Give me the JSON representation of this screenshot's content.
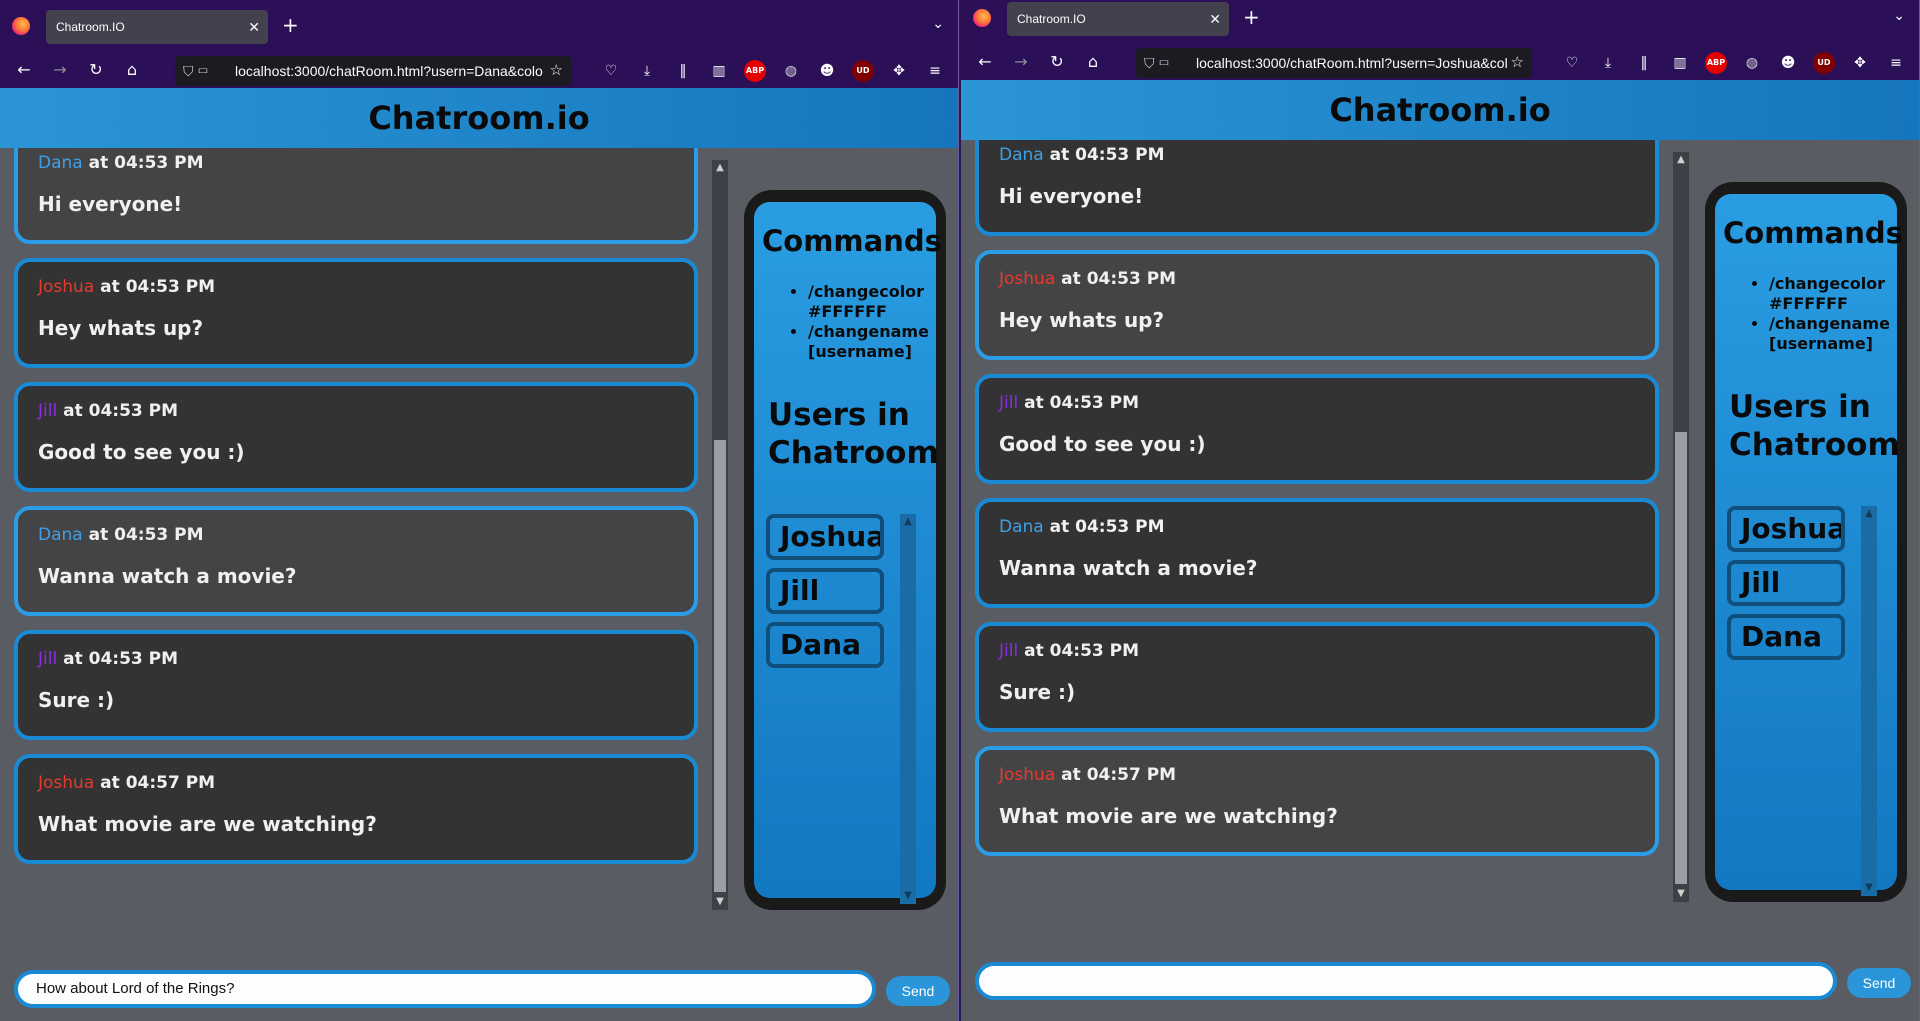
{
  "colors": {
    "accent": "#1a8ad4",
    "dana": "#3f9fe6",
    "joshua": "#e83a2a",
    "jill": "#8a2ee0",
    "browser_chrome": "#2b1057"
  },
  "left": {
    "tab_title": "Chatroom.IO",
    "url": "localhost:3000/chatRoom.html?usern=Dana&colo",
    "app_title": "Chatroom.io",
    "messages": [
      {
        "user": "Dana",
        "time": "at 04:53 PM",
        "text": "Hi everyone!",
        "own": true
      },
      {
        "user": "Joshua",
        "time": "at 04:53 PM",
        "text": "Hey whats up?",
        "own": false
      },
      {
        "user": "Jill",
        "time": "at 04:53 PM",
        "text": "Good to see you :)",
        "own": false
      },
      {
        "user": "Dana",
        "time": "at 04:53 PM",
        "text": "Wanna watch a movie?",
        "own": true
      },
      {
        "user": "Jill",
        "time": "at 04:53 PM",
        "text": "Sure :)",
        "own": false
      },
      {
        "user": "Joshua",
        "time": "at 04:57 PM",
        "text": "What movie are we watching?",
        "own": false
      }
    ],
    "commands_title": "Commands",
    "commands": [
      "/changecolor #FFFFFF",
      "/changename [username]"
    ],
    "users_title": "Users in Chatroom",
    "users": [
      "Joshua",
      "Jill",
      "Dana"
    ],
    "input_value": "How about Lord of the Rings?",
    "send_label": "Send"
  },
  "right": {
    "tab_title": "Chatroom.IO",
    "url": "localhost:3000/chatRoom.html?usern=Joshua&col",
    "app_title": "Chatroom.io",
    "messages": [
      {
        "user": "Dana",
        "time": "at 04:53 PM",
        "text": "Hi everyone!",
        "own": false
      },
      {
        "user": "Joshua",
        "time": "at 04:53 PM",
        "text": "Hey whats up?",
        "own": true
      },
      {
        "user": "Jill",
        "time": "at 04:53 PM",
        "text": "Good to see you :)",
        "own": false
      },
      {
        "user": "Dana",
        "time": "at 04:53 PM",
        "text": "Wanna watch a movie?",
        "own": false
      },
      {
        "user": "Jill",
        "time": "at 04:53 PM",
        "text": "Sure :)",
        "own": false
      },
      {
        "user": "Joshua",
        "time": "at 04:57 PM",
        "text": "What movie are we watching?",
        "own": true
      }
    ],
    "commands_title": "Commands",
    "commands": [
      "/changecolor #FFFFFF",
      "/changename [username]"
    ],
    "users_title": "Users in Chatroom",
    "users": [
      "Joshua",
      "Jill",
      "Dana"
    ],
    "input_value": "",
    "send_label": "Send"
  }
}
